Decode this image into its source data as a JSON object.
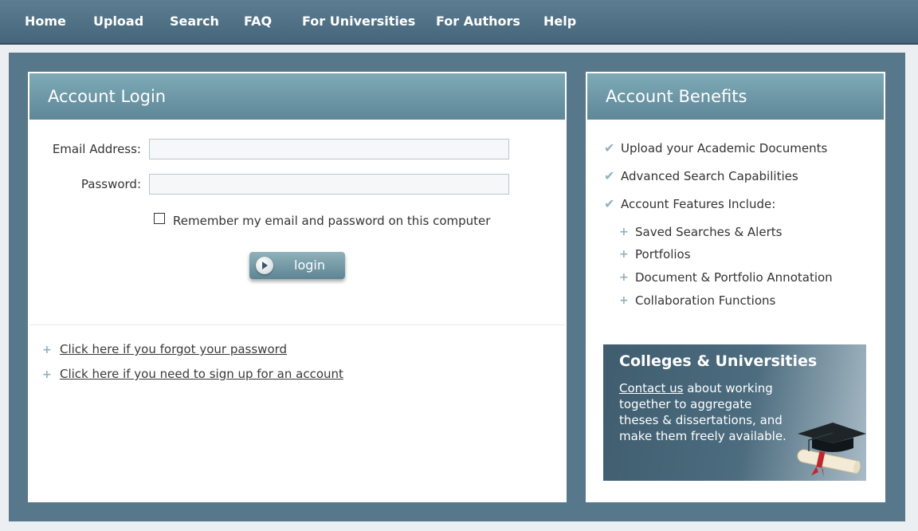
{
  "nav": {
    "items": [
      "Home",
      "Upload",
      "Search",
      "FAQ",
      "For Universities",
      "For Authors",
      "Help"
    ]
  },
  "login": {
    "title": "Account Login",
    "email_label": "Email Address:",
    "email_value": "",
    "password_label": "Password:",
    "password_value": "",
    "remember_label": "Remember my email and password on this computer",
    "remember_checked": false,
    "login_button": "login",
    "forgot_link": "Click here if you forgot your password",
    "signup_link": "Click here if you need to sign up for an account"
  },
  "benefits": {
    "title": "Account Benefits",
    "items": [
      "Upload your Academic Documents",
      "Advanced Search Capabilities",
      "Account Features Include:"
    ],
    "features": [
      "Saved Searches & Alerts",
      "Portfolios",
      "Document & Portfolio Annotation",
      "Collaboration Functions"
    ]
  },
  "promo": {
    "title": "Colleges & Universities",
    "contact_link": "Contact us",
    "body": " about working together to aggregate theses & dissertations, and make them freely available."
  },
  "colors": {
    "nav_bg": "#4f6f83",
    "frame_bg": "#57788a",
    "panel_header": "#6f98a6",
    "accent": "#8fb0c2"
  }
}
